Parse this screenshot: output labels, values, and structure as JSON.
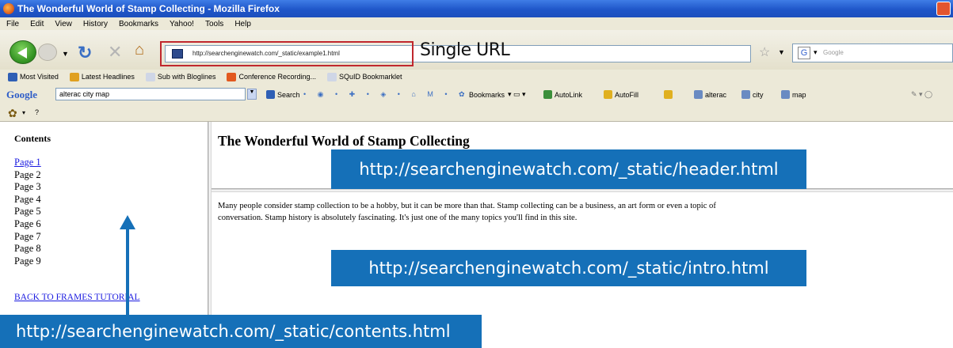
{
  "window": {
    "title": "The Wonderful World of Stamp Collecting - Mozilla Firefox"
  },
  "menu": [
    "File",
    "Edit",
    "View",
    "History",
    "Bookmarks",
    "Yahoo!",
    "Tools",
    "Help"
  ],
  "navbar": {
    "url": "http://searchenginewatch.com/_static/example1.html",
    "single_url_label": "Single URL",
    "search_placeholder": "Google",
    "search_engine_icon": "G"
  },
  "bookmarks": [
    {
      "label": "Most Visited",
      "icon_color": "#2f5fb5"
    },
    {
      "label": "Latest Headlines",
      "icon_color": "#e0a020"
    },
    {
      "label": "Sub with Bloglines",
      "icon_color": "#cfd6e6"
    },
    {
      "label": "Conference Recording...",
      "icon_color": "#e2591f"
    },
    {
      "label": "SQuID Bookmarklet",
      "icon_color": "#cfd6e6"
    }
  ],
  "google_toolbar": {
    "logo": "Google",
    "query": "alterac city map",
    "items": [
      {
        "label": "Search",
        "icon_color": "#2f5fb5"
      },
      {
        "label": "Bookmarks",
        "icon_color": "#e0b020"
      },
      {
        "label": "AutoLink",
        "icon_color": "#3c8f3a"
      },
      {
        "label": "AutoFill",
        "icon_color": "#e0b020"
      },
      {
        "label": "alterac",
        "icon_color": "#6a8bc2"
      },
      {
        "label": "city",
        "icon_color": "#6a8bc2"
      },
      {
        "label": "map",
        "icon_color": "#6a8bc2"
      }
    ]
  },
  "mini_toolbar": {
    "help": "?"
  },
  "contents_frame": {
    "heading": "Contents",
    "pages": [
      "Page 1",
      "Page 2",
      "Page 3",
      "Page 4",
      "Page 5",
      "Page 6",
      "Page 7",
      "Page 8",
      "Page 9"
    ],
    "back_link": "BACK TO FRAMES TUTORIAL"
  },
  "header_frame": {
    "title": "The Wonderful World of Stamp Collecting"
  },
  "intro_frame": {
    "line1": "Many people consider stamp collection to be a hobby, but it can be more than that. Stamp collecting can be a business, an art form or even a topic of",
    "line2": "conversation. Stamp history is absolutely fascinating. It's just one of the many topics you'll find in this site."
  },
  "callouts": {
    "header": "http://searchenginewatch.com/_static/header.html",
    "intro": "http://searchenginewatch.com/_static/intro.html",
    "contents": "http://searchenginewatch.com/_static/contents.html"
  },
  "colors": {
    "callout_blue": "#1570b8",
    "highlight_red": "#c0272d",
    "link_blue": "#1a1ae0"
  }
}
